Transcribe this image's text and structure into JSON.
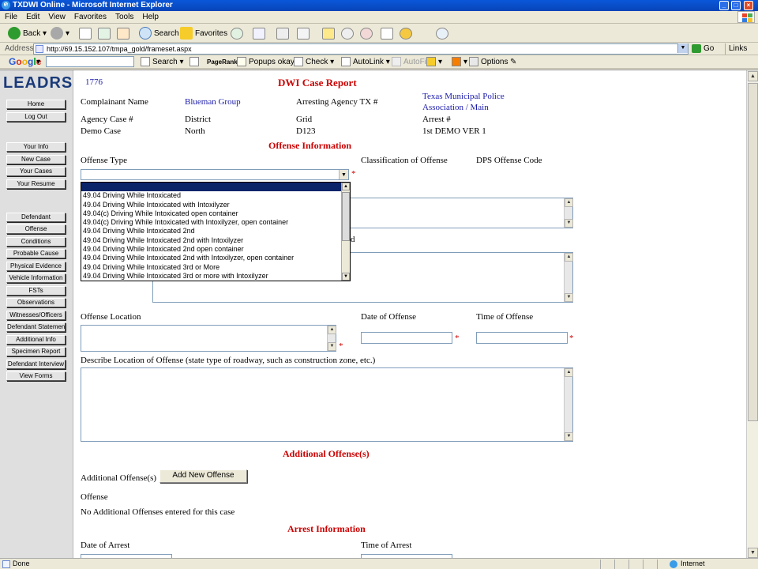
{
  "window": {
    "title": "TXDWI Online - Microsoft Internet Explorer",
    "controls": [
      "_",
      "□",
      "×"
    ]
  },
  "menu": [
    "File",
    "Edit",
    "View",
    "Favorites",
    "Tools",
    "Help"
  ],
  "toolbar": {
    "back": "Back",
    "search": "Search",
    "favorites": "Favorites"
  },
  "address": {
    "label": "Address",
    "url": "http://69.15.152.107/tmpa_gold/frameset.aspx",
    "go": "Go",
    "links": "Links"
  },
  "googlebar": {
    "logo": "Google",
    "search": "Search",
    "pagerank": "PageRank",
    "popups": "Popups okay",
    "check": "Check",
    "autolink": "AutoLink",
    "autofill": "AutoFill",
    "options": "Options"
  },
  "sidebar": {
    "logo": "LEADRS",
    "group1": [
      "Home",
      "Log Out"
    ],
    "group2": [
      "Your Info",
      "New Case",
      "Your Cases",
      "Your Resume"
    ],
    "group3": [
      "Defendant",
      "Offense",
      "Conditions",
      "Probable Cause",
      "Physical Evidence",
      "Vehicle Information",
      "FSTs",
      "Observations",
      "Witnesses/Officers",
      "Defendant Statement",
      "Additional Info",
      "Specimen Report",
      "Defendant Interview",
      "View Forms"
    ]
  },
  "report": {
    "case_number": "1776",
    "title": "DWI Case Report",
    "complainant_label": "Complainant Name",
    "complainant_value": "Blueman Group",
    "arresting_agency_label": "Arresting Agency TX #",
    "arresting_agency_value_line1": "Texas Municipal Police",
    "arresting_agency_value_line2": "Association / Main",
    "agency_case_label": "Agency Case #",
    "agency_case_value": "Demo Case",
    "district_label": "District",
    "district_value": "North",
    "grid_label": "Grid",
    "grid_value": "D123",
    "arrest_label": "Arrest #",
    "arrest_value": "1st DEMO VER 1"
  },
  "offense_info": {
    "heading": "Offense Information",
    "offense_type_label": "Offense Type",
    "classification_label": "Classification of Offense",
    "dps_code_label": "DPS Offense Code",
    "required_mark": "*",
    "partial_label": "d",
    "dropdown_options": [
      "",
      "49.04 Driving While Intoxicated",
      "49.04 Driving While Intoxicated with Intoxilyzer",
      "49.04(c) Driving While Intoxicated open container",
      "49.04(c) Driving While Intoxicated with Intoxilyzer, open container",
      "49.04 Driving While Intoxicated 2nd",
      "49.04 Driving While Intoxicated 2nd with Intoxilyzer",
      "49.04 Driving While Intoxicated 2nd open container",
      "49.04 Driving While Intoxicated 2nd with Intoxilyzer, open container",
      "49.04 Driving While Intoxicated 3rd or More",
      "49.04 Driving While Intoxicated 3rd or more with Intoxilyzer"
    ],
    "location_label": "Offense Location",
    "date_label": "Date of Offense",
    "time_label": "Time of Offense",
    "describe_label": "Describe Location of Offense (state type of roadway, such as construction zone, etc.)"
  },
  "additional": {
    "heading": "Additional Offense(s)",
    "label": "Additional Offense(s)",
    "button": "Add New Offense",
    "offense_label": "Offense",
    "none_text": "No Additional Offenses entered for this case"
  },
  "arrest_info": {
    "heading": "Arrest Information",
    "date_label": "Date of Arrest",
    "time_label": "Time of Arrest"
  },
  "status": {
    "text": "Done",
    "zone": "Internet"
  },
  "colors": {
    "heading_red": "#cc0000",
    "link_blue": "#1a1aaa",
    "selected_option": "#0a246a",
    "titlebar_blue": "#0844b8"
  }
}
